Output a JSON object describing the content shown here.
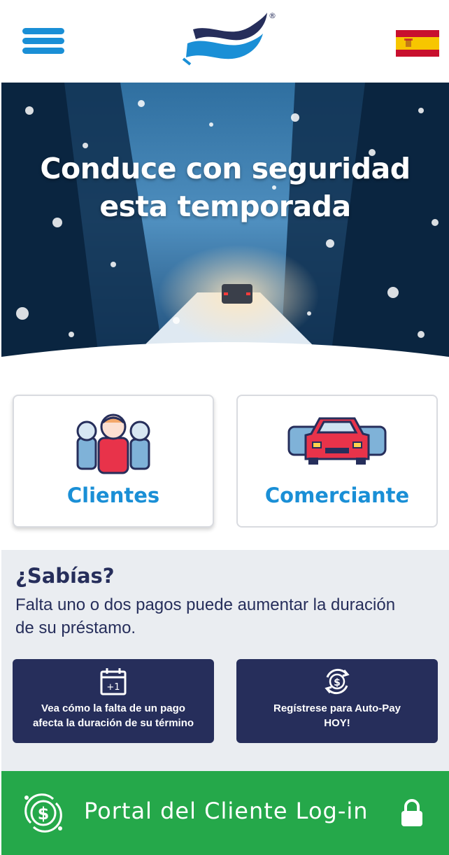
{
  "header": {
    "menu_icon": "hamburger-menu-icon",
    "logo_icon": "wave-flag-logo",
    "registered_mark": "®",
    "language_icon": "spain-flag-icon"
  },
  "hero": {
    "title_line1": "Conduce con seguridad",
    "title_line2": "esta temporada"
  },
  "cards": {
    "clientes": {
      "label": "Clientes",
      "icon": "family-people-icon"
    },
    "comerciante": {
      "label": "Comerciante",
      "icon": "cars-icon"
    }
  },
  "did_you_know": {
    "title": "¿Sabías?",
    "text": "Falta uno o dos pagos puede aumentar la duración de su préstamo.",
    "actions": [
      {
        "label_line1": "Vea cómo la falta de un pago",
        "label_line2": "afecta la duración de su término",
        "icon": "calendar-plus-one-icon",
        "icon_text": "+1"
      },
      {
        "label_line1": "Regístrese para Auto-Pay",
        "label_line2": "HOY!",
        "icon": "dollar-cycle-icon"
      }
    ]
  },
  "portal": {
    "label": "Portal del Cliente Log-in",
    "icon": "dollar-coin-icon",
    "lock_icon": "lock-icon"
  },
  "colors": {
    "accent_blue": "#1a8fd6",
    "navy": "#262e5b",
    "green": "#25a84a",
    "info_bg": "#eaedf1"
  }
}
